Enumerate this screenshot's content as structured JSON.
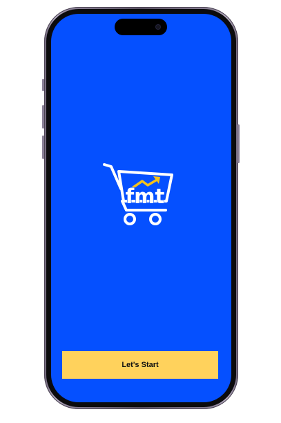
{
  "app": {
    "logo_text": "fmt",
    "start_button_label": "Let's Start"
  },
  "icons": {
    "logo": "shopping-cart-trend-arrow-icon",
    "camera": "front-camera-icon"
  },
  "colors": {
    "screen_background": "#0550ff",
    "button_background": "#ffd25c",
    "logo_primary": "#ffffff",
    "logo_accent": "#f4c21a"
  }
}
